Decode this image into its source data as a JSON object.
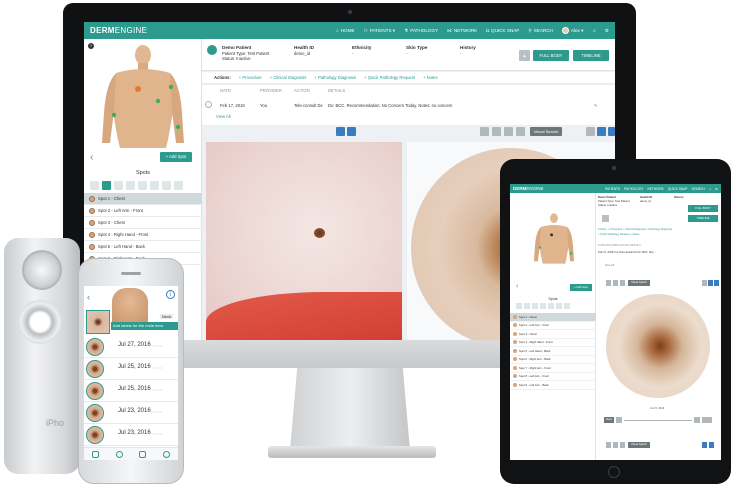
{
  "imac": {
    "nav": {
      "brand_bold": "DERM",
      "brand_light": "ENGINE",
      "items": [
        "HOME",
        "PATIENTS ▾",
        "PATHOLOGY",
        "NETWORK",
        "QUICK SNAP",
        "SEARCH",
        "Alex ▾"
      ]
    },
    "patient": {
      "name": "Demo Patient",
      "type_line": "Patient Type: Test Patient",
      "status_line": "Status: Inactive",
      "health_id_label": "Health ID",
      "health_id_value": "demo_id",
      "ethnicity_label": "Ethnicity",
      "ethnicity_value": "-",
      "skin_type_label": "Skin Type",
      "skin_type_value": "-",
      "history_label": "History",
      "history_value": "-",
      "fullbody_label": "FULL BODY",
      "timeline_label": "TIMELINE"
    },
    "actions": {
      "label": "Actions:",
      "items": [
        "+ Procedure",
        "+ Clinical Diagnosis",
        "+ Pathology Diagnosis",
        "+ Quick Pathology Request",
        "+ Notes"
      ]
    },
    "history_table": {
      "headers": [
        "DATE",
        "PROVIDER",
        "ACTION",
        "DETAILS"
      ],
      "row": [
        "Feb 17, 2018",
        "You",
        "Tele-consult Dx",
        "Dx: BCC. Recommendation: No Concern Today. Notes: no concern"
      ],
      "view_all": "View All"
    },
    "spots": {
      "add_label": "+ Add Spot",
      "title": "Spots",
      "items": [
        "Spot 1 - Chest",
        "Spot 2 - Left Arm - Front",
        "Spot 3 - Chest",
        "Spot 4 - Right Hand - Front",
        "Spot 5 - Left Hand - Back",
        "Spot 6 - Right Arm - Back"
      ]
    },
    "image_toolbar": {
      "visual_search": "Visual Search"
    }
  },
  "iphone": {
    "banner": "Add labels for the mole here.",
    "neck_label": "Neck",
    "entries": [
      {
        "date": "Jul 27, 2016"
      },
      {
        "date": "Jul 25, 2016"
      },
      {
        "date": "Jul 25, 2016"
      },
      {
        "date": "Jul 23, 2016"
      },
      {
        "date": "Jul 23, 2016"
      }
    ],
    "attachment_text": "iPho"
  },
  "ipad": {
    "nav": {
      "brand_bold": "DERM",
      "brand_light": "ENGINE",
      "items": [
        "PATIENTS",
        "PATHOLOGY",
        "NETWORK",
        "QUICK SNAP",
        "SEARCH"
      ]
    },
    "patient": {
      "name": "Demo Patient",
      "type_line": "Patient Type: Test Patient",
      "status_line": "Status: Inactive",
      "health_id_label": "Health ID",
      "health_id_value": "demo_id",
      "history_label": "History",
      "fullbody_label": "FULL BODY",
      "timeline_label": "TIMELINE"
    },
    "actions_line1": "Actions:  + Procedure   + Clinical Diagnosis   + Pathology Diagnosis",
    "actions_line2": "+ Quick Pathology Request   + Notes",
    "history_headers": "DATE        PROVIDER        ACTION        DETAILS",
    "history_row": "Feb 17, 2018    You    Tele-consult Dx    Dx: BCC. Rec...",
    "view_all": "View All",
    "spots_title": "Spots",
    "spots": [
      "Spot 1 - Chest",
      "Spot 2 - Left Arm - Front",
      "Spot 3 - Chest",
      "Spot 4 - Right Hand - Front",
      "Spot 5 - Left Hand - Back",
      "Spot 6 - Right Arm - Back",
      "Spot 7 - Right Arm - Front",
      "Spot 8 - Left Arm - Front",
      "Spot 9 - Left Arm - Back"
    ],
    "add_spot": "+ Add Spot",
    "visual_search": "Visual Search",
    "image_caption": "Jul 27, 2016",
    "reset_label": "Reset"
  },
  "colors": {
    "accent": "#2d9a8e",
    "toolbar_blue": "#3b7bbf"
  }
}
